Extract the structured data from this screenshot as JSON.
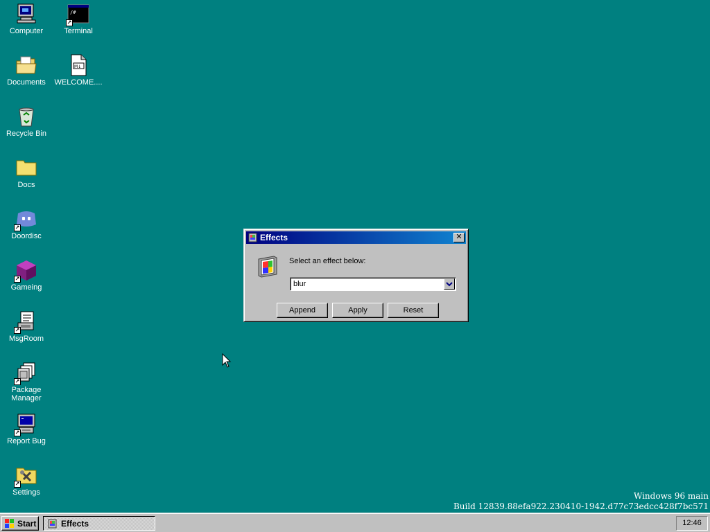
{
  "desktop": {
    "icons": [
      {
        "label": "Computer",
        "icon": "computer-icon"
      },
      {
        "label": "Terminal",
        "icon": "terminal-icon"
      },
      {
        "label": "Documents",
        "icon": "documents-folder-icon"
      },
      {
        "label": "WELCOME....",
        "icon": "markdown-file-icon"
      },
      {
        "label": "Recycle Bin",
        "icon": "recycle-bin-icon"
      },
      {
        "label": "Docs",
        "icon": "folder-icon"
      },
      {
        "label": "Doordisc",
        "icon": "doordisc-icon"
      },
      {
        "label": "Gameing",
        "icon": "game-cube-icon"
      },
      {
        "label": "MsgRoom",
        "icon": "msgroom-icon"
      },
      {
        "label": "Package Manager",
        "icon": "package-manager-icon"
      },
      {
        "label": "Report Bug",
        "icon": "report-bug-icon"
      },
      {
        "label": "Settings",
        "icon": "settings-icon"
      }
    ]
  },
  "dialog": {
    "title": "Effects",
    "prompt": "Select an effect below:",
    "select_value": "blur",
    "buttons": {
      "append": "Append",
      "apply": "Apply",
      "reset": "Reset"
    },
    "close_symbol": "✕"
  },
  "build_info": {
    "line1": "Windows 96 main",
    "line2": "Build 12839.88efa922.230410-1942.d77c73edcc428f7bc571"
  },
  "taskbar": {
    "start_label": "Start",
    "task_label": "Effects",
    "clock": "12:46"
  },
  "colors": {
    "desktop": "#008080",
    "titlebar_start": "#000080",
    "titlebar_end": "#1084d0",
    "chrome": "#c0c0c0"
  }
}
